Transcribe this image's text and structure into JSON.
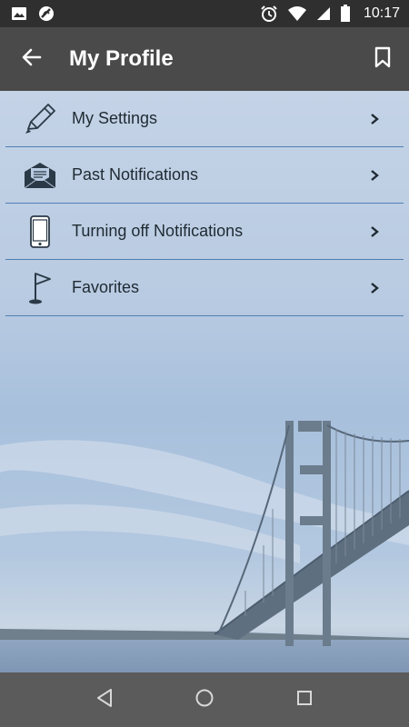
{
  "status_bar": {
    "time": "10:17",
    "left_icons": [
      "image-icon",
      "circle-slash-icon"
    ],
    "right_icons": [
      "alarm-icon",
      "wifi-icon",
      "signal-icon",
      "battery-icon"
    ]
  },
  "app_bar": {
    "title": "My Profile",
    "back_icon": "arrow-left-icon",
    "action_icon": "bookmark-icon"
  },
  "menu": {
    "items": [
      {
        "label": "My Settings",
        "icon": "pencil-icon"
      },
      {
        "label": "Past Notifications",
        "icon": "envelope-icon"
      },
      {
        "label": "Turning off Notifications",
        "icon": "phone-icon"
      },
      {
        "label": "Favorites",
        "icon": "flag-icon"
      }
    ]
  },
  "nav_bar": {
    "icons": [
      "back-triangle-icon",
      "home-circle-icon",
      "recents-square-icon"
    ]
  },
  "colors": {
    "status_bar": "#2f2f2f",
    "app_bar": "#4a4a4a",
    "divider": "#4f7fb4",
    "menu_text": "#1f2a33",
    "nav_bar": "#5b5b5b"
  }
}
